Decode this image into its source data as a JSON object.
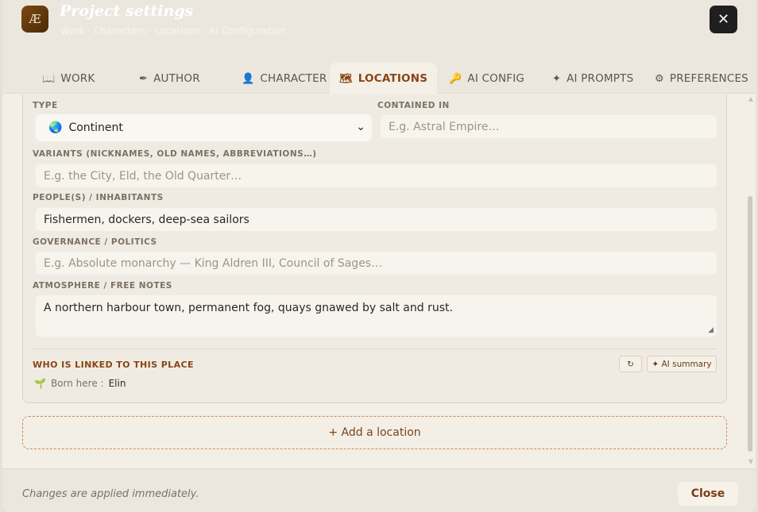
{
  "header": {
    "logo": "Æ",
    "title": "Project settings",
    "subtitle": "Work · Characters · Locations · AI Configuration",
    "close_icon": "close-icon"
  },
  "tabs": [
    {
      "label": "WORK",
      "icon": "📖"
    },
    {
      "label": "AUTHOR",
      "icon": "✒"
    },
    {
      "label": "CHARACTER",
      "icon": "👤"
    },
    {
      "label": "LOCATIONS",
      "icon": "🗺"
    },
    {
      "label": "AI CONFIG",
      "icon": "🔑"
    },
    {
      "label": "AI PROMPTS",
      "icon": "✦"
    },
    {
      "label": "PREFERENCES",
      "icon": "⚙"
    }
  ],
  "location": {
    "type_label": "TYPE",
    "type_icon": "🌏",
    "type_value": "Continent",
    "contained_label": "CONTAINED IN",
    "contained_placeholder": "E.g. Astral Empire…",
    "variants_label": "VARIANTS (NICKNAMES, OLD NAMES, ABBREVIATIONS…)",
    "variants_placeholder": "E.g. the City, Eld, the Old Quarter…",
    "people_label": "PEOPLE(S) / INHABITANTS",
    "people_value": "Fishermen, dockers, deep-sea sailors",
    "governance_label": "GOVERNANCE / POLITICS",
    "governance_placeholder": "E.g. Absolute monarchy — King Aldren III, Council of Sages…",
    "atmosphere_label": "ATMOSPHERE / FREE NOTES",
    "atmosphere_value": "A northern harbour town, permanent fog, quays gnawed by salt and rust.",
    "linked_title": "WHO IS LINKED TO THIS PLACE",
    "refresh_icon": "↻",
    "ai_summary": "✦ AI summary",
    "born_icon": "🌱",
    "born_label": "Born here :",
    "born_value": "Elin"
  },
  "add_location": "+ Add a location",
  "footer": {
    "note": "Changes are applied immediately.",
    "close": "Close"
  }
}
